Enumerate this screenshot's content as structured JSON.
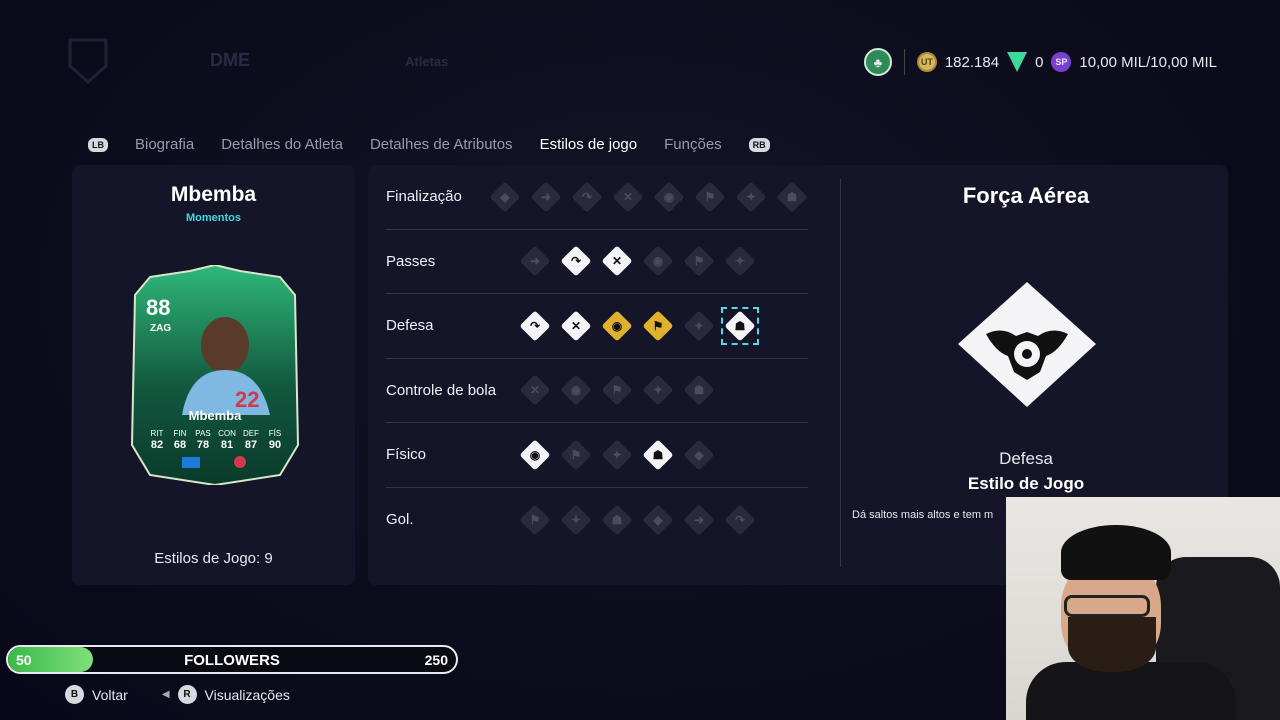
{
  "header": {
    "ghost_label_1": "DME",
    "ghost_label_2": "Atletas",
    "coins": "182.184",
    "points": "0",
    "sp": "10,00 MIL/10,00 MIL"
  },
  "tabs": {
    "lb": "LB",
    "rb": "RB",
    "items": [
      {
        "label": "Biografia"
      },
      {
        "label": "Detalhes do Atleta"
      },
      {
        "label": "Detalhes de Atributos"
      },
      {
        "label": "Estilos de jogo",
        "active": true
      },
      {
        "label": "Funções"
      }
    ]
  },
  "player": {
    "name": "Mbemba",
    "subtitle": "Momentos",
    "rating": "88",
    "position": "ZAG",
    "card_name": "Mbemba",
    "stats_labels": [
      "RIT",
      "FIN",
      "PAS",
      "CON",
      "DEF",
      "FÍS"
    ],
    "stats_values": [
      "82",
      "68",
      "78",
      "81",
      "87",
      "90"
    ],
    "shirt_number": "22",
    "estilos_count": "Estilos de Jogo: 9"
  },
  "playstyles": [
    {
      "label": "Finalização",
      "icons": [
        "dim",
        "dim",
        "dim",
        "dim",
        "dim",
        "dim",
        "dim",
        "dim"
      ]
    },
    {
      "label": "Passes",
      "icons": [
        "dim",
        "white",
        "white",
        "dim",
        "dim",
        "dim"
      ]
    },
    {
      "label": "Defesa",
      "icons": [
        "white",
        "white",
        "gold",
        "gold",
        "dim",
        "selected"
      ]
    },
    {
      "label": "Controle de bola",
      "icons": [
        "dim",
        "dim",
        "dim",
        "dim",
        "dim"
      ]
    },
    {
      "label": "Físico",
      "icons": [
        "white",
        "dim",
        "dim",
        "white",
        "dim"
      ]
    },
    {
      "label": "Gol.",
      "icons": [
        "dim",
        "dim",
        "dim",
        "dim",
        "dim",
        "dim"
      ]
    }
  ],
  "detail": {
    "title": "Força Aérea",
    "category": "Defesa",
    "type": "Estilo de Jogo",
    "description": "Dá saltos mais altos e tem m"
  },
  "followers": {
    "start": "50",
    "label": "FOLLOWERS",
    "end": "250",
    "progress": 0.19
  },
  "footer": {
    "back_key": "B",
    "back_label": "Voltar",
    "view_key": "R",
    "view_label": "Visualizações"
  }
}
